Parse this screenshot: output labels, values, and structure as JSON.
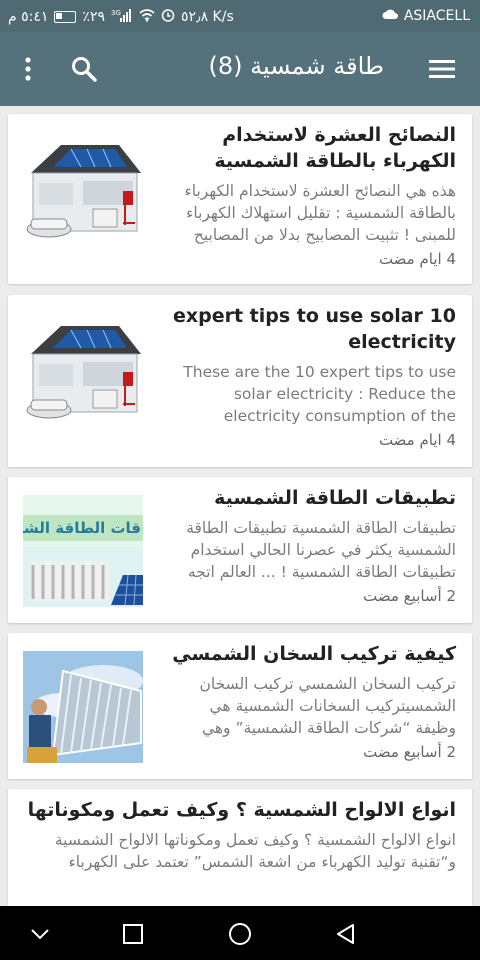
{
  "status": {
    "carrier": "ASIACELL",
    "time": "٥:٤١ م",
    "battery": "٪٢٩",
    "speed": "٥٢٫٨ K/s",
    "network": "3G"
  },
  "appbar": {
    "title": "طاقة شمسية (8)",
    "menu_icon": "menu-icon",
    "search_icon": "search-icon",
    "more_icon": "more-vert-icon"
  },
  "cards": [
    {
      "title": "النصائح العشرة  لاستخدام الكهرباء بالطاقة الشمسية",
      "desc": "هذه هي النصائح العشرة  لاستخدام الكهرباء بالطاقة الشمسية : تقليل استهلاك الكهرباء للمبنى !  تثبيت المصابيح بدلا من المصابيح",
      "time": "4 ايام مضت",
      "image": "solar-house"
    },
    {
      "title": "10 expert tips to use solar electricity",
      "desc": "These are the 10 expert tips to use solar electricity : Reduce the electricity consumption of the",
      "time": "4 ايام مضت",
      "image": "solar-house"
    },
    {
      "title": "تطبيقات الطاقة الشمسية",
      "desc": "تطبيقات الطاقة الشمسية    تطبيقات الطاقة الشمسية يكثر في عصرنا الحالي استخدام تطبيقات الطاقة الشمسية ! ...  العالم اتجه",
      "time": "2 أسابيع مضت",
      "image": "solar-applications",
      "image_text": "قات الطاقة الشد"
    },
    {
      "title": "كيفية تركيب السخان الشمسي",
      "desc": "تركيب السخان الشمسي تركيب السخان الشمسيتركيب السخانات الشمسية هي وظيفة “شركات الطاقة الشمسية” وهي",
      "time": "2 أسابيع مضت",
      "image": "solar-heater"
    },
    {
      "title": "انواع الالواح الشمسية ؟  وكيف تعمل ومكوناتها",
      "desc": "انواع الالواح الشمسية ؟  وكيف تعمل ومكوناتها الالواح الشمسية و“تقنية توليد الكهرباء من اشعة الشمس” تعتمد على الكهرباء",
      "time": "",
      "image": "none"
    }
  ],
  "navbar": {
    "back_icon": "back-triangle-icon",
    "home_icon": "home-circle-icon",
    "recents_icon": "recents-square-icon",
    "hide_icon": "chevron-down-icon"
  }
}
